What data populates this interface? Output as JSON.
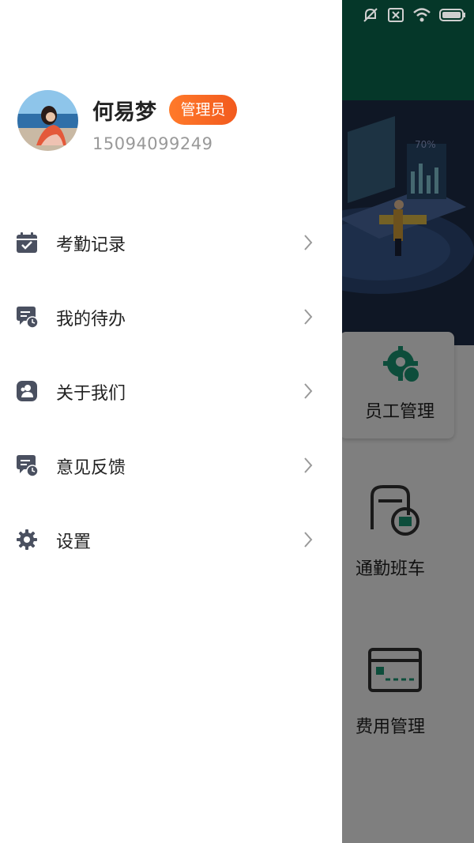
{
  "background_app": {
    "tiles": [
      {
        "label": "员工管理",
        "icon": "gear-user-icon"
      },
      {
        "label": "通勤班车",
        "icon": "bus-icon"
      },
      {
        "label": "费用管理",
        "icon": "card-icon"
      }
    ],
    "banner_text": "70%"
  },
  "status_bar": {
    "icons": [
      "mute-icon",
      "no-sim-icon",
      "wifi-icon",
      "battery-icon"
    ]
  },
  "user": {
    "name": "何易梦",
    "role": "管理员",
    "phone": "15094099249"
  },
  "menu": [
    {
      "label": "考勤记录",
      "icon": "calendar-check-icon"
    },
    {
      "label": "我的待办",
      "icon": "todo-clock-icon"
    },
    {
      "label": "关于我们",
      "icon": "about-users-icon"
    },
    {
      "label": "意见反馈",
      "icon": "feedback-clock-icon"
    },
    {
      "label": "设置",
      "icon": "gear-icon"
    }
  ],
  "colors": {
    "badge": "#f26a25",
    "icon": "#4a5060",
    "brand": "#0b6e53"
  }
}
